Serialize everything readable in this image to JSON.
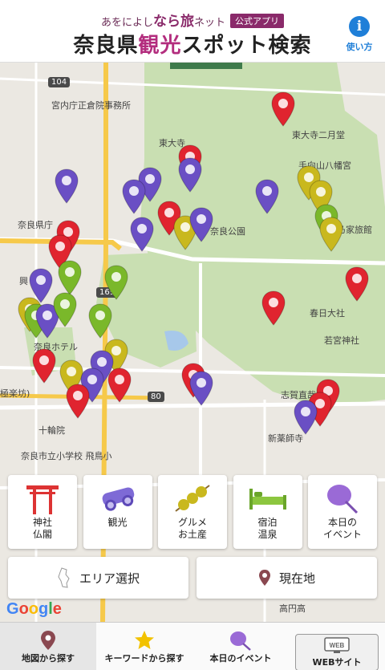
{
  "header": {
    "brand_prefix": "あをによし",
    "brand_main": "なら旅",
    "brand_suffix": "ネット",
    "badge": "公式アプリ",
    "title_pre": "奈良県",
    "title_accent": "観光",
    "title_post": "スポット検索",
    "help_icon": "i",
    "help_label": "使い方"
  },
  "map": {
    "labels": {
      "imperial": "宮内庁正倉院事務所",
      "todaiji": "東大寺",
      "nigatsudo": "東大寺二月堂",
      "tamukeyama": "手向山八幡宮",
      "prefecture": "奈良県庁",
      "nara_park": "奈良公園",
      "yoshikien": "乃家旅館",
      "kasuga": "春日大社",
      "wakamiya": "若宮神社",
      "hotel": "奈良ホテル",
      "gokuraku": "極楽坊)",
      "shiga": "志賀直哉旧居",
      "jurin": "十輪院",
      "shinyakushi": "新薬師寺",
      "school": "奈良市立小学校 飛鳥小",
      "takamado": "高円高",
      "station": "興"
    },
    "roads": {
      "r104": "104",
      "r169": "169",
      "r80": "80"
    },
    "google": [
      "G",
      "o",
      "o",
      "g",
      "l",
      "e"
    ]
  },
  "categories": [
    {
      "label": "神社\n仏閣",
      "icon": "torii-icon"
    },
    {
      "label": "観光",
      "icon": "binoculars-icon"
    },
    {
      "label": "グルメ\nお土産",
      "icon": "dango-icon"
    },
    {
      "label": "宿泊\n温泉",
      "icon": "bed-icon"
    },
    {
      "label": "本日の\nイベント",
      "icon": "fan-icon"
    }
  ],
  "actions": {
    "area": "エリア選択",
    "current": "現在地"
  },
  "nav": {
    "map_search": "地図から探す",
    "keyword_search": "キーワードから探す",
    "today_event": "本日のイベント",
    "web_site": "WEBサイト",
    "web_icon_text": "WEB"
  },
  "colors": {
    "shrine_pin": "#e0242f",
    "sightseeing_pin": "#6a4fc4",
    "gourmet_pin": "#c9b81e",
    "lodging_pin": "#7ab82a",
    "accent": "#b32d7e",
    "park": "#c9dfb2"
  }
}
